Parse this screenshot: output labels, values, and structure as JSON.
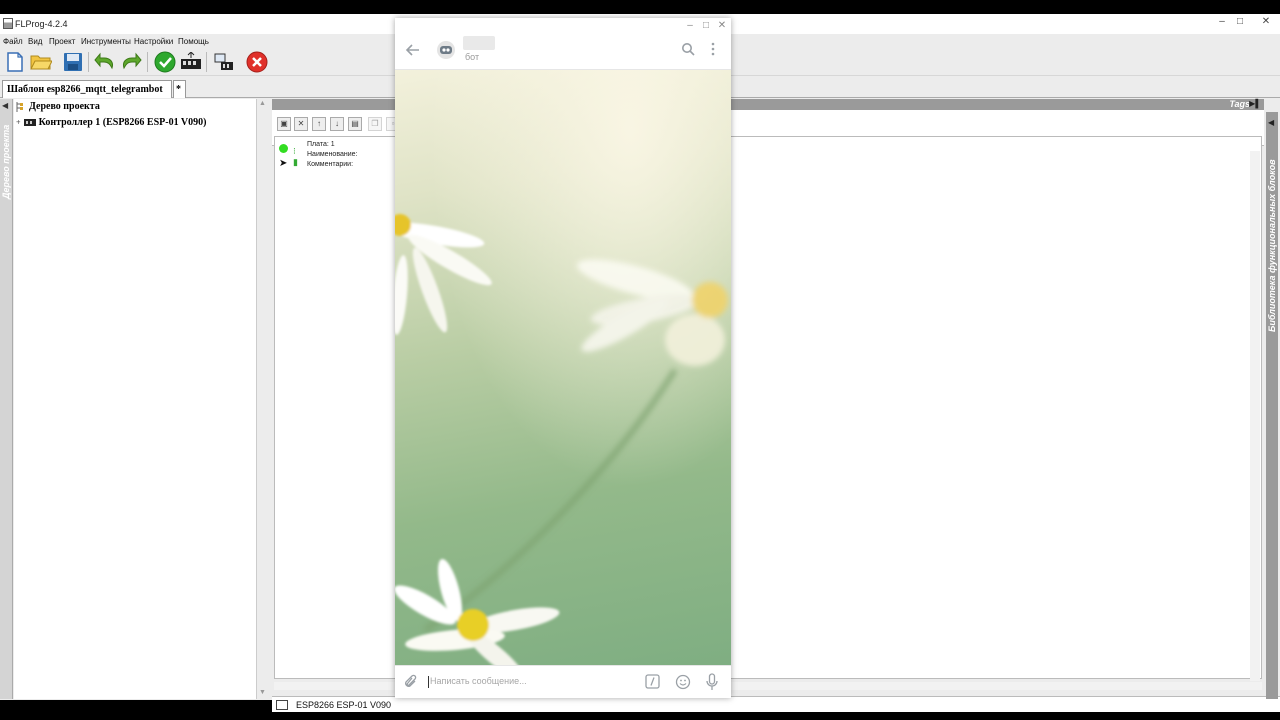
{
  "flprog": {
    "title": "FLProg-4.2.4",
    "window_controls": [
      "–",
      "□",
      "✕"
    ],
    "menu": [
      "Файл",
      "Вид",
      "Проект",
      "Инструменты",
      "Настройки",
      "Помощь"
    ],
    "toolbar_icons": [
      "new-file-icon",
      "open-folder-icon",
      "save-icon",
      "undo-icon",
      "redo-icon",
      "compile-check-icon",
      "upload-icon",
      "board-settings-icon",
      "stop-icon"
    ],
    "tab": {
      "label": "Шаблон esp8266_mqtt_telegrambot",
      "star": "*"
    },
    "left_panel": {
      "vertical_label": "Дерево проекта",
      "tree": [
        {
          "label": "Дерево проекта"
        },
        {
          "label": "Контроллер 1 (ESP8266 ESP-01 V090)"
        }
      ]
    },
    "editor": {
      "tags_label": "Tags",
      "board_info": {
        "plate": "Плата: 1",
        "name": "Наименование:",
        "comment": "Комментарии:"
      }
    },
    "right_panel": {
      "vertical_label": "Библиотека функциональных блоков"
    },
    "status": {
      "text": "ESP8266 ESP-01 V090"
    },
    "colors": {
      "stop_red": "#e0302a",
      "ok_green": "#2ea82e",
      "indicator": "#33dd22"
    }
  },
  "telegram": {
    "window_controls": [
      "–",
      "□",
      "✕"
    ],
    "chat": {
      "status": "бот"
    },
    "input": {
      "placeholder": "Написать сообщение..."
    },
    "icons": [
      "back-arrow-icon",
      "bot-avatar-icon",
      "search-icon",
      "more-vert-icon",
      "attach-icon",
      "bot-command-icon",
      "emoji-icon",
      "mic-icon"
    ]
  }
}
